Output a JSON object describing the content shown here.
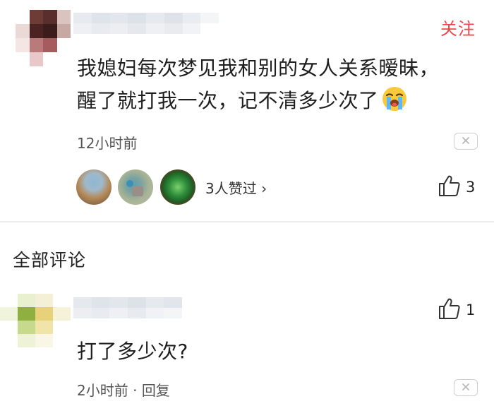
{
  "post": {
    "follow_label": "关注",
    "text_line1": "我媳妇每次梦见我和别的女人关系暧昧，",
    "text_line2": "醒了就打我一次，记不清多少次了",
    "emoji": "crying-face",
    "time": "12小时前",
    "likers_label": "3人赞过 ›",
    "like_count": "3"
  },
  "section_title": "全部评论",
  "comment": {
    "text": "打了多少次?",
    "time": "2小时前",
    "separator": " · ",
    "reply_label": "回复",
    "like_count": "1"
  },
  "colors": {
    "accent": "#f0464b",
    "text": "#1e1e1e",
    "secondary": "#555555",
    "divider": "#ececec"
  }
}
